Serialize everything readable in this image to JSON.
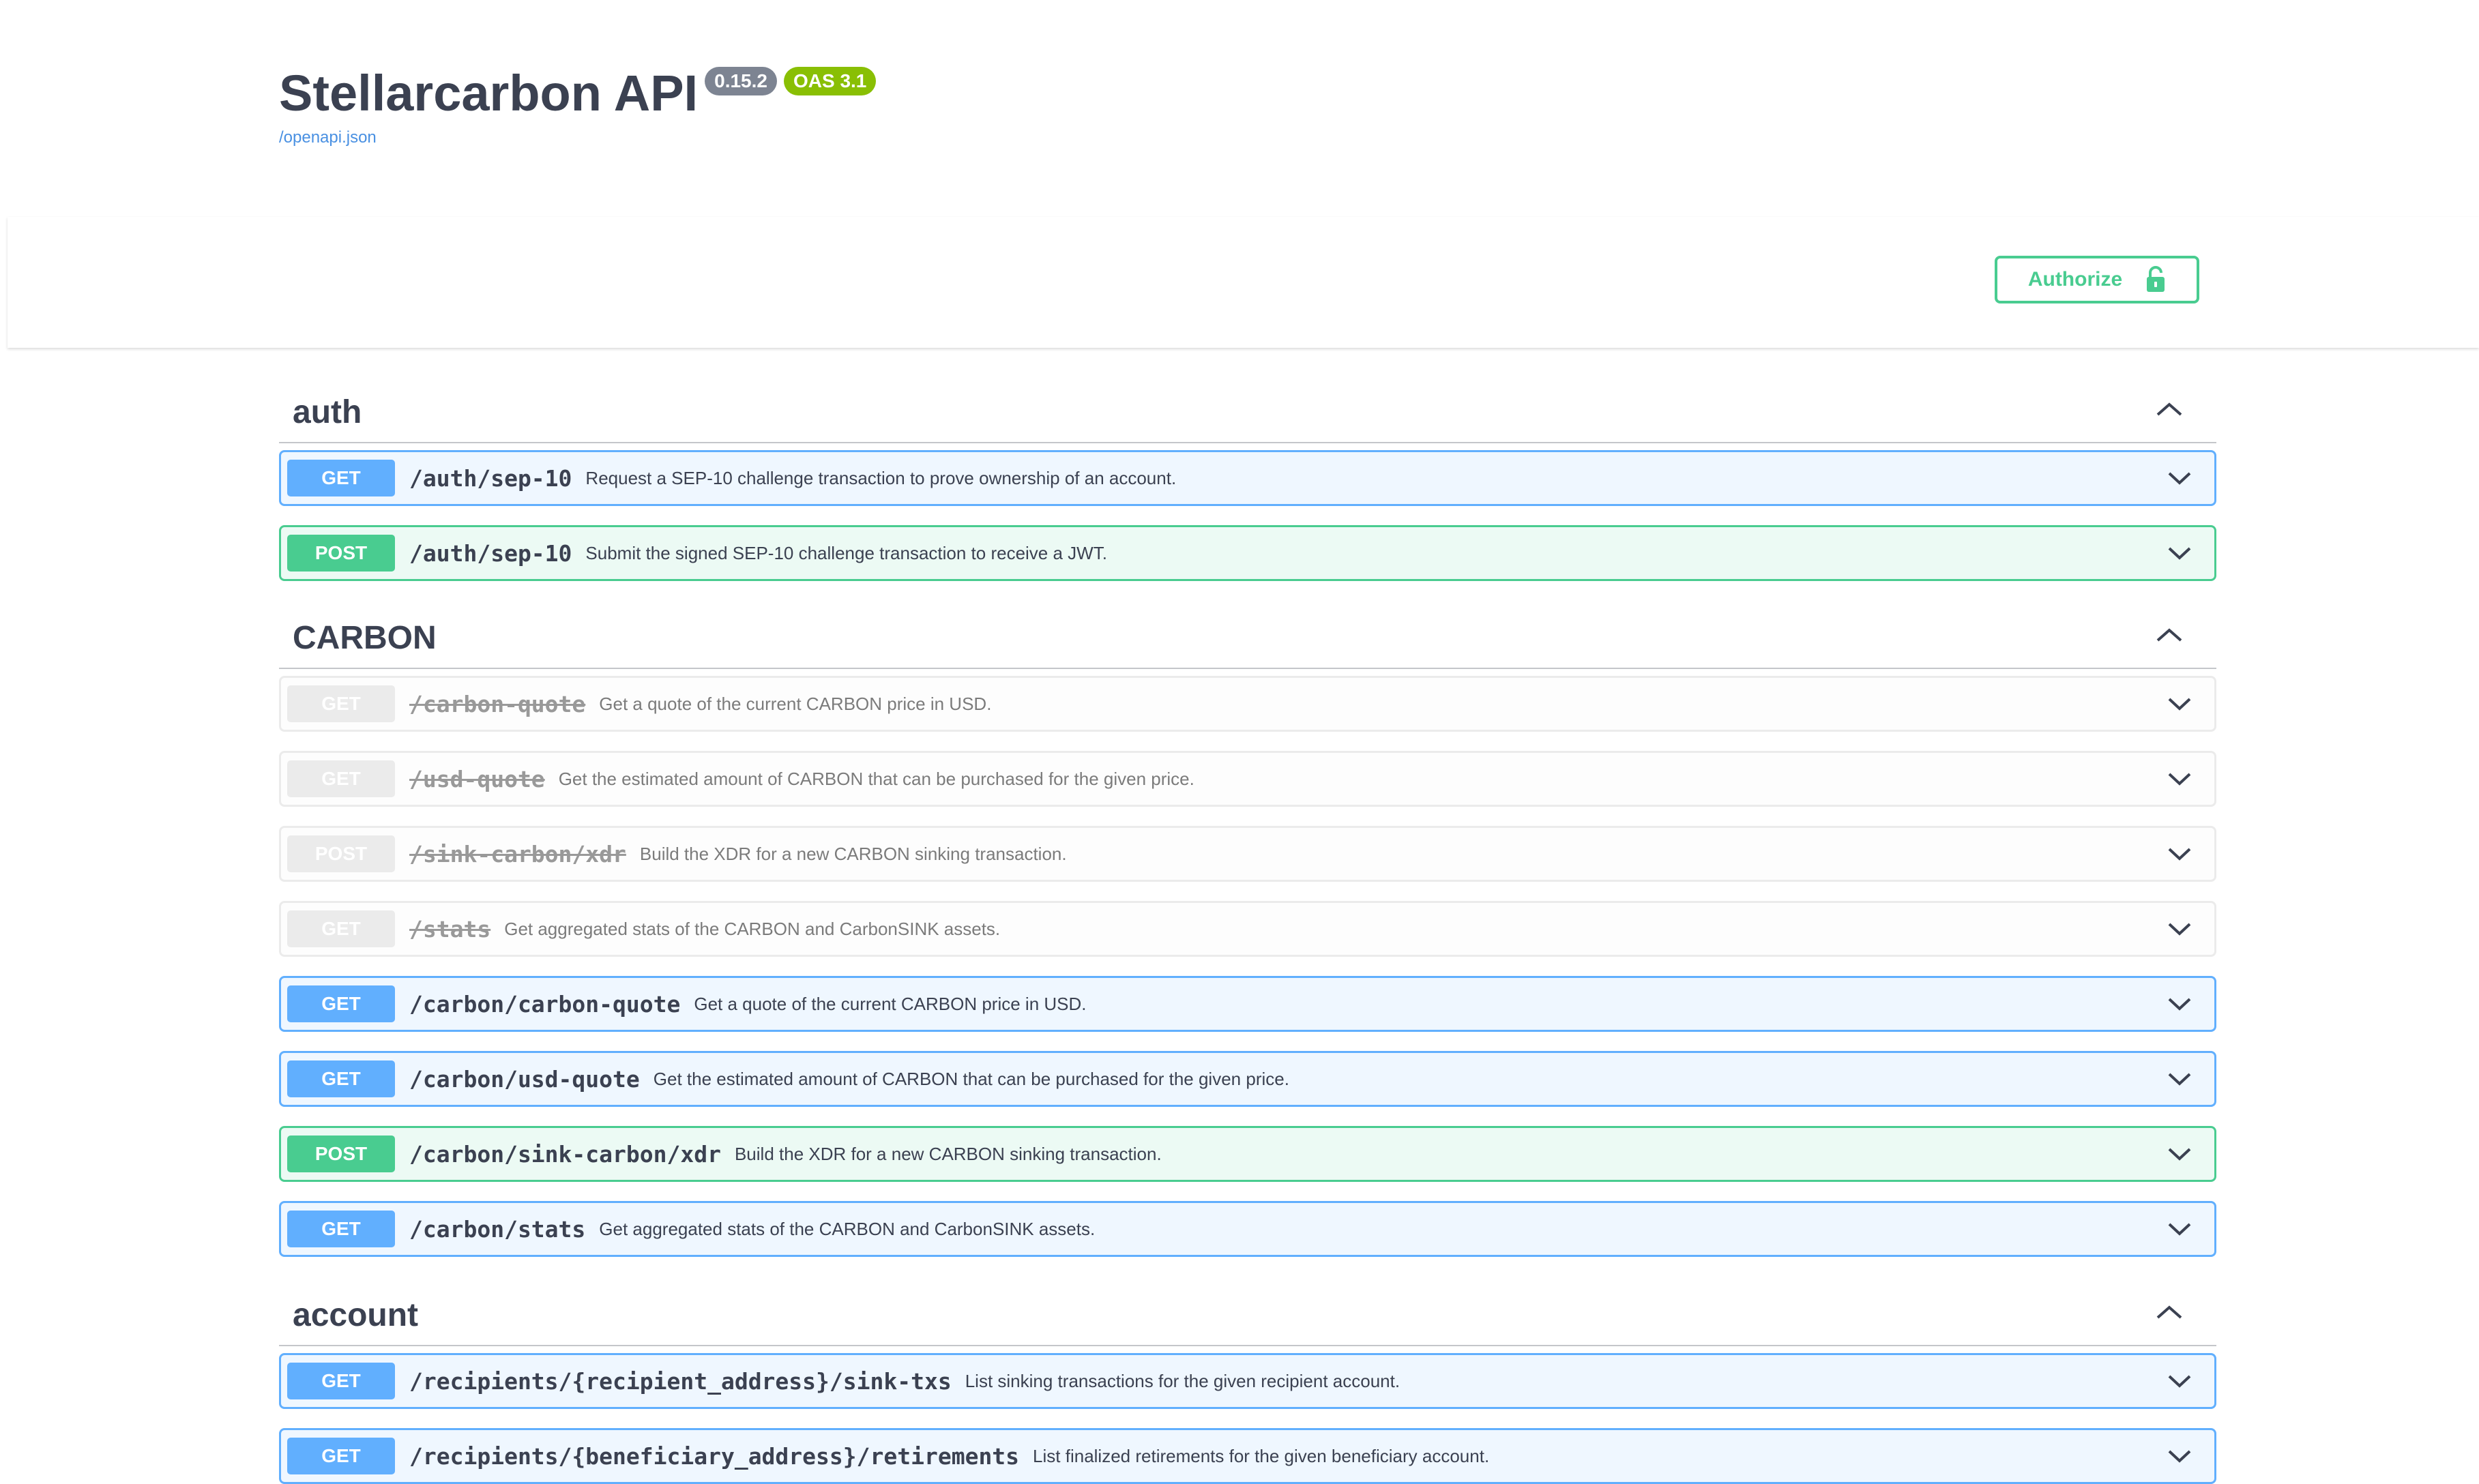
{
  "info": {
    "title": "Stellarcarbon API",
    "version": "0.15.2",
    "oas": "OAS 3.1",
    "spec_url": "/openapi.json"
  },
  "authorize": {
    "label": "Authorize",
    "icon": "unlocked-padlock-icon"
  },
  "colors": {
    "get": "#61affe",
    "post": "#49cc90",
    "deprecated": "#ebebeb",
    "text": "#3b4151",
    "link": "#4990e2",
    "version_badge": "#7d8492",
    "oas_badge": "#89bf04"
  },
  "tags": [
    {
      "name": "auth",
      "operations": [
        {
          "method": "GET",
          "path": "/auth/sep-10",
          "summary": "Request a SEP-10 challenge transaction to prove ownership of an account.",
          "deprecated": false
        },
        {
          "method": "POST",
          "path": "/auth/sep-10",
          "summary": "Submit the signed SEP-10 challenge transaction to receive a JWT.",
          "deprecated": false
        }
      ]
    },
    {
      "name": "CARBON",
      "operations": [
        {
          "method": "GET",
          "path": "/carbon-quote",
          "summary": "Get a quote of the current CARBON price in USD.",
          "deprecated": true
        },
        {
          "method": "GET",
          "path": "/usd-quote",
          "summary": "Get the estimated amount of CARBON that can be purchased for the given price.",
          "deprecated": true
        },
        {
          "method": "POST",
          "path": "/sink-carbon/xdr",
          "summary": "Build the XDR for a new CARBON sinking transaction.",
          "deprecated": true
        },
        {
          "method": "GET",
          "path": "/stats",
          "summary": "Get aggregated stats of the CARBON and CarbonSINK assets.",
          "deprecated": true
        },
        {
          "method": "GET",
          "path": "/carbon/carbon-quote",
          "summary": "Get a quote of the current CARBON price in USD.",
          "deprecated": false
        },
        {
          "method": "GET",
          "path": "/carbon/usd-quote",
          "summary": "Get the estimated amount of CARBON that can be purchased for the given price.",
          "deprecated": false
        },
        {
          "method": "POST",
          "path": "/carbon/sink-carbon/xdr",
          "summary": "Build the XDR for a new CARBON sinking transaction.",
          "deprecated": false
        },
        {
          "method": "GET",
          "path": "/carbon/stats",
          "summary": "Get aggregated stats of the CARBON and CarbonSINK assets.",
          "deprecated": false
        }
      ]
    },
    {
      "name": "account",
      "operations": [
        {
          "method": "GET",
          "path": "/recipients/{recipient_address}/sink-txs",
          "summary": "List sinking transactions for the given recipient account.",
          "deprecated": false
        },
        {
          "method": "GET",
          "path": "/recipients/{beneficiary_address}/retirements",
          "summary": "List finalized retirements for the given beneficiary account.",
          "deprecated": false
        }
      ]
    }
  ]
}
